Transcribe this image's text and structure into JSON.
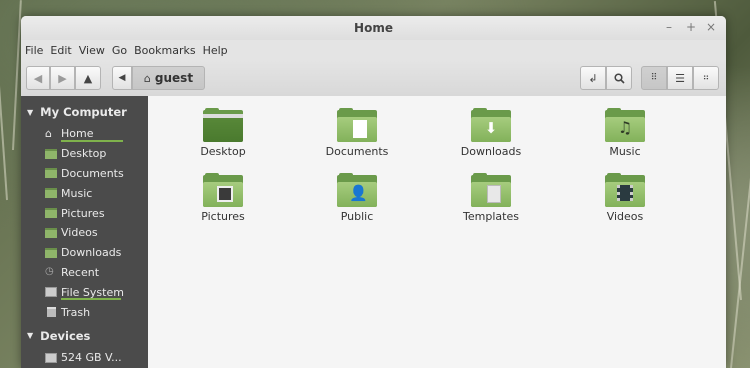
{
  "window": {
    "title": "Home",
    "controls": {
      "minimize": "–",
      "maximize": "+",
      "close": "×"
    }
  },
  "menubar": [
    "File",
    "Edit",
    "View",
    "Go",
    "Bookmarks",
    "Help"
  ],
  "toolbar": {
    "back_icon": "back-arrow-icon",
    "forward_icon": "forward-arrow-icon",
    "up_icon": "up-arrow-icon",
    "path_toggle_icon": "left-triangle-icon",
    "location": "guest",
    "location_icon": "home-icon",
    "toggle_location_icon": "location-entry-icon",
    "search_icon": "search-icon",
    "views": [
      "icon-view",
      "list-view",
      "compact-view"
    ],
    "active_view": "icon-view"
  },
  "sidebar": {
    "sections": [
      {
        "title": "My Computer",
        "items": [
          {
            "label": "Home",
            "icon": "home-icon",
            "usage": true
          },
          {
            "label": "Desktop",
            "icon": "desktop-icon"
          },
          {
            "label": "Documents",
            "icon": "folder-icon"
          },
          {
            "label": "Music",
            "icon": "music-folder-icon"
          },
          {
            "label": "Pictures",
            "icon": "pictures-folder-icon"
          },
          {
            "label": "Videos",
            "icon": "videos-folder-icon"
          },
          {
            "label": "Downloads",
            "icon": "downloads-folder-icon"
          },
          {
            "label": "Recent",
            "icon": "recent-icon"
          },
          {
            "label": "File System",
            "icon": "drive-icon",
            "usage": true
          },
          {
            "label": "Trash",
            "icon": "trash-icon"
          }
        ]
      },
      {
        "title": "Devices",
        "items": [
          {
            "label": "524 GB V...",
            "icon": "drive-icon"
          }
        ]
      }
    ]
  },
  "files": [
    {
      "label": "Desktop",
      "icon": "desktop-folder-icon"
    },
    {
      "label": "Documents",
      "icon": "documents-folder-icon"
    },
    {
      "label": "Downloads",
      "icon": "downloads-folder-icon"
    },
    {
      "label": "Music",
      "icon": "music-folder-icon"
    },
    {
      "label": "Pictures",
      "icon": "pictures-folder-icon"
    },
    {
      "label": "Public",
      "icon": "public-folder-icon"
    },
    {
      "label": "Templates",
      "icon": "templates-folder-icon"
    },
    {
      "label": "Videos",
      "icon": "videos-folder-icon"
    }
  ],
  "colors": {
    "accent": "#7fb24c",
    "sidebar_bg": "#4b4b4b",
    "folder_green": "#82b15a"
  }
}
